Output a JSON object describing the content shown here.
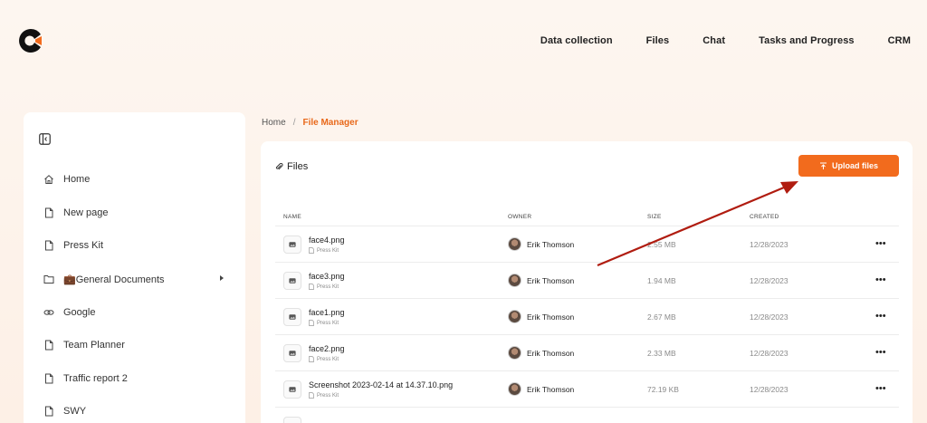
{
  "nav": {
    "items": [
      {
        "label": "Data collection"
      },
      {
        "label": "Files"
      },
      {
        "label": "Chat"
      },
      {
        "label": "Tasks and Progress"
      },
      {
        "label": "CRM"
      }
    ]
  },
  "sidebar": {
    "items": [
      {
        "label": "Home",
        "icon": "home-icon"
      },
      {
        "label": "New page",
        "icon": "page-icon"
      },
      {
        "label": "Press Kit",
        "icon": "page-icon"
      },
      {
        "label": "💼General Documents",
        "icon": "folder-icon"
      },
      {
        "label": "Google",
        "icon": "link-icon"
      },
      {
        "label": "Team Planner",
        "icon": "page-icon"
      },
      {
        "label": "Traffic report 2",
        "icon": "page-icon"
      },
      {
        "label": "SWY",
        "icon": "page-icon"
      }
    ]
  },
  "breadcrumb": {
    "home": "Home",
    "separator": "/",
    "current": "File Manager"
  },
  "files": {
    "title": "Files",
    "upload_label": "Upload files",
    "columns": {
      "name": "NAME",
      "owner": "OWNER",
      "size": "SIZE",
      "created": "CREATED"
    },
    "rows": [
      {
        "name": "face4.png",
        "folder": "Press Kit",
        "owner": "Erik Thomson",
        "size": "2.55 MB",
        "created": "12/28/2023"
      },
      {
        "name": "face3.png",
        "folder": "Press Kit",
        "owner": "Erik Thomson",
        "size": "1.94 MB",
        "created": "12/28/2023"
      },
      {
        "name": "face1.png",
        "folder": "Press Kit",
        "owner": "Erik Thomson",
        "size": "2.67 MB",
        "created": "12/28/2023"
      },
      {
        "name": "face2.png",
        "folder": "Press Kit",
        "owner": "Erik Thomson",
        "size": "2.33 MB",
        "created": "12/28/2023"
      },
      {
        "name": "Screenshot 2023-02-14 at 14.37.10.png",
        "folder": "Press Kit",
        "owner": "Erik Thomson",
        "size": "72.19 KB",
        "created": "12/28/2023"
      }
    ]
  },
  "colors": {
    "accent": "#f26b1d",
    "breadcrumb_active": "#e8681a",
    "annotation_arrow": "#b01c10"
  }
}
